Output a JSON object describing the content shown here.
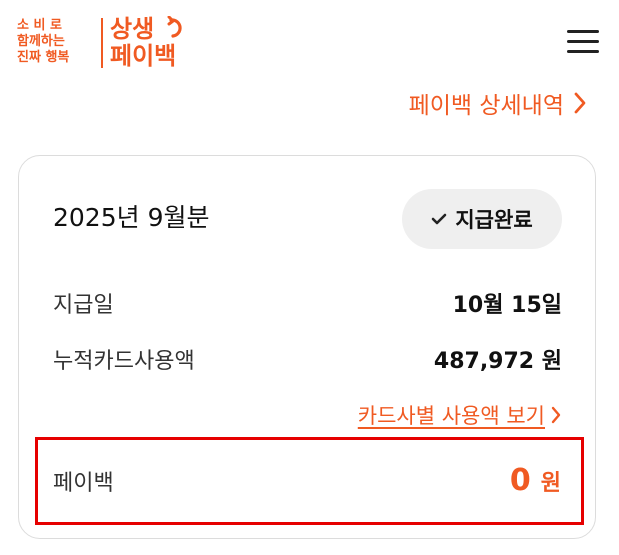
{
  "header": {
    "logo_small_lines": [
      "소 비 로",
      "함께하는",
      "진짜 행복"
    ],
    "logo_big_line1": "상생",
    "logo_big_line2": "페이백",
    "menu_icon": "hamburger-menu-icon"
  },
  "history_link": {
    "label": "페이백 상세내역",
    "icon": "chevron-right-icon"
  },
  "card": {
    "month": "2025년 9월분",
    "status": {
      "label": "지급완료",
      "icon": "check-icon"
    },
    "rows": [
      {
        "label": "지급일",
        "value": "10월 15일"
      },
      {
        "label": "누적카드사용액",
        "value": "487,972 원"
      }
    ],
    "detail_link": {
      "label": "카드사별 사용액 보기",
      "icon": "chevron-right-icon"
    },
    "payback": {
      "label": "페이백",
      "amount": "0",
      "unit": "원"
    }
  },
  "colors": {
    "accent": "#f05a22",
    "highlight": "#e60000",
    "badge_bg": "#efefef",
    "border": "#dcdcdc"
  }
}
